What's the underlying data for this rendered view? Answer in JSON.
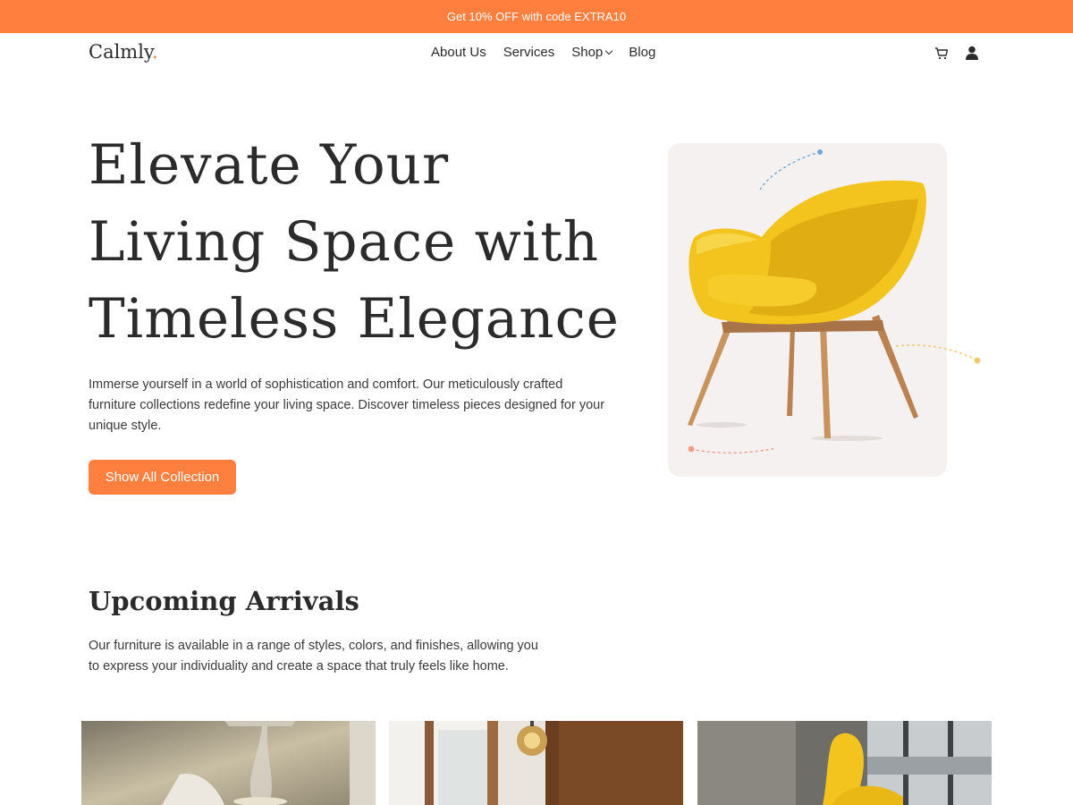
{
  "promo": {
    "text": "Get 10% OFF with code EXTRA10"
  },
  "header": {
    "logo_text": "Calmly",
    "logo_dot": ".",
    "nav": [
      {
        "label": "About Us"
      },
      {
        "label": "Services"
      },
      {
        "label": "Shop",
        "has_dropdown": true
      },
      {
        "label": "Blog"
      }
    ],
    "icons": [
      "cart-icon",
      "user-icon"
    ]
  },
  "hero": {
    "title_lines": [
      "Elevate Your",
      "Living Space with",
      "Timeless Elegance"
    ],
    "description": "Immerse yourself in a world of sophistication and comfort. Our meticulously crafted furniture collections redefine your living space. Discover timeless pieces designed for your unique style.",
    "button_label": "Show All Collection",
    "image": "yellow-armchair"
  },
  "arrivals": {
    "title": "Upcoming Arrivals",
    "description": "Our furniture is available in a range of styles, colors, and finishes, allowing you to express your individuality and create a space that truly feels like home.",
    "images": [
      "bedside-lamp-photo",
      "pendant-light-room-photo",
      "yellow-chair-window-photo"
    ]
  },
  "colors": {
    "accent": "#ff7f3f",
    "text": "#2b2b2b",
    "card_bg": "#f5f1f0",
    "chair_yellow": "#f2c41d"
  }
}
